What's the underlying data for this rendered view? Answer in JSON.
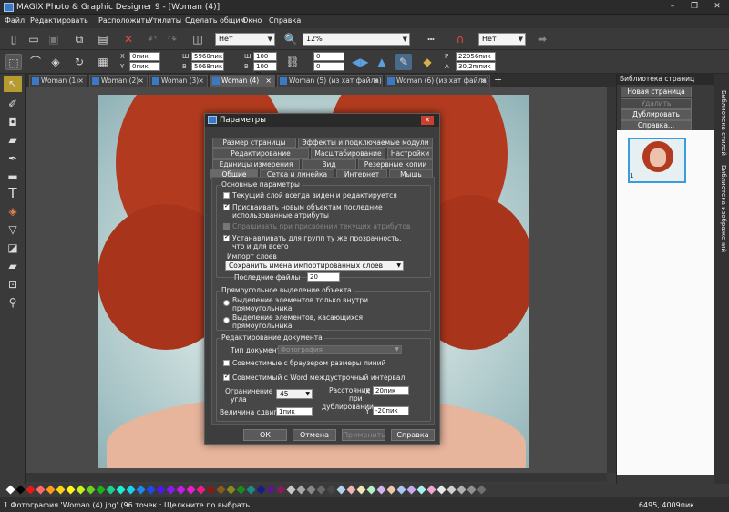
{
  "window": {
    "title": "MAGIX Photo & Graphic Designer 9 - [Woman (4)]"
  },
  "menu": [
    "Файл",
    "Редактировать",
    "Расположить",
    "Утилиты",
    "Сделать общим",
    "Окно",
    "Справка"
  ],
  "toolbar1": {
    "fill_combo": "Нет",
    "zoom_combo": "12%",
    "outline_combo": "Нет"
  },
  "toolbar2": {
    "x_label": "X",
    "x_value": "0пик",
    "y_label": "Y",
    "y_value": "0пик",
    "w_label": "Ш",
    "w_value": "5960пик",
    "h_label": "В",
    "h_value": "5068пик",
    "w_pct": "100 %",
    "h_pct": "100 %",
    "rot_value": "0",
    "skew_value": "0",
    "p_label": "P",
    "p_value": "22056пик",
    "a_label": "A",
    "a_value": "30,2mпик"
  },
  "tabs": [
    {
      "label": "Woman (1)"
    },
    {
      "label": "Woman (2)"
    },
    {
      "label": "Woman (3)"
    },
    {
      "label": "Woman (4)",
      "active": true
    },
    {
      "label": "Woman (5)  (из хат файла)*"
    },
    {
      "label": "Woman (6)  (из хат файла)*"
    }
  ],
  "right_panel": {
    "title": "Библиотека страниц",
    "buttons": [
      "Новая страница",
      "Удалить",
      "Дублировать",
      "Справка..."
    ],
    "thumb_number": "1",
    "side_tabs": [
      "Библиотека стилей",
      "Библиотека изображений"
    ]
  },
  "status": {
    "text": "1 Фотография 'Woman (4).jpg' (96 точек : Щелкните по выбрать",
    "coords": "6495, 4009пик"
  },
  "palette_colors": [
    "#ffffff",
    "#000000",
    "#e51a1a",
    "#ff6a6a",
    "#ff9a1a",
    "#ffd21a",
    "#fff41a",
    "#c8f01a",
    "#6ad21a",
    "#1ab41a",
    "#1ad28a",
    "#1af0d2",
    "#1ad2f0",
    "#1a8af0",
    "#1a4af0",
    "#4a1af0",
    "#8a1af0",
    "#c81af0",
    "#f01ad2",
    "#f01a8a",
    "#8a1a1a",
    "#8a5a1a",
    "#8a8a1a",
    "#1a8a1a",
    "#1a8a8a",
    "#1a1a8a",
    "#5a1a8a",
    "#8a1a5a",
    "#c8c8c8",
    "#a8a8a8",
    "#888888",
    "#686868",
    "#484848",
    "#b4d2f0",
    "#f0b4b4",
    "#f0e6b4",
    "#b4f0c8",
    "#d2b4f0",
    "#f0c8a8",
    "#a8c8f0",
    "#c8a8f0",
    "#a8f0f0",
    "#f0a8d2",
    "#e8e8e8",
    "#d0d0d0",
    "#b0b0b0",
    "#909090",
    "#707070"
  ],
  "dialog": {
    "title": "Параметры",
    "tabs_row1": [
      "Размер страницы",
      "Эффекты и подключаемые модули"
    ],
    "tabs_row2": [
      "Редактирование фотографий",
      "Масштабирование",
      "Настройки"
    ],
    "tabs_row3": [
      "Единицы измерения",
      "Вид",
      "Резервные копии"
    ],
    "tabs_row4": [
      "Общие",
      "Сетка и линейка",
      "Интернет",
      "Мышь"
    ],
    "basic": {
      "title": "Основные параметры",
      "opt1": "Текущий слой всегда виден и редактируется",
      "opt2a": "Присваивать новым объектам последние",
      "opt2b": "использованные атрибуты",
      "opt3": "Спрашивать при присвоении текущих атрибутов",
      "opt4a": "Устанавливать для групп ту же прозрачность,",
      "opt4b": "что и для всего",
      "import_label": "Импорт слоев",
      "import_value": "Сохранить имена импортированных слоев",
      "recent_label": "Последние файлы",
      "recent_value": "20"
    },
    "rect": {
      "title": "Прямоугольное выделение объекта",
      "opt1a": "Выделение элементов только внутри",
      "opt1b": "прямоугольника",
      "opt2a": "Выделение элементов, касающихся",
      "opt2b": "прямоугольника"
    },
    "docedit": {
      "title": "Редактирование документа",
      "type_label": "Тип документа",
      "type_value": "Фотография",
      "opt1": "Совместимые с браузером размеры линий",
      "opt2": "Совместимый с Word междустрочный интервал",
      "angle_label1": "Ограничение",
      "angle_label2": "угла",
      "angle_value": "45",
      "shift_label": "Величина сдвига",
      "shift_value": "1пик",
      "dist_label1": "Расстояние",
      "dist_label2": "при",
      "dist_label3": "дублировании",
      "dx_label": "X",
      "dx_value": "20пик",
      "dy_label": "Y",
      "dy_value": "-20пик"
    },
    "buttons": {
      "ok": "ОК",
      "cancel": "Отмена",
      "apply": "Применить",
      "help": "Справка"
    }
  }
}
